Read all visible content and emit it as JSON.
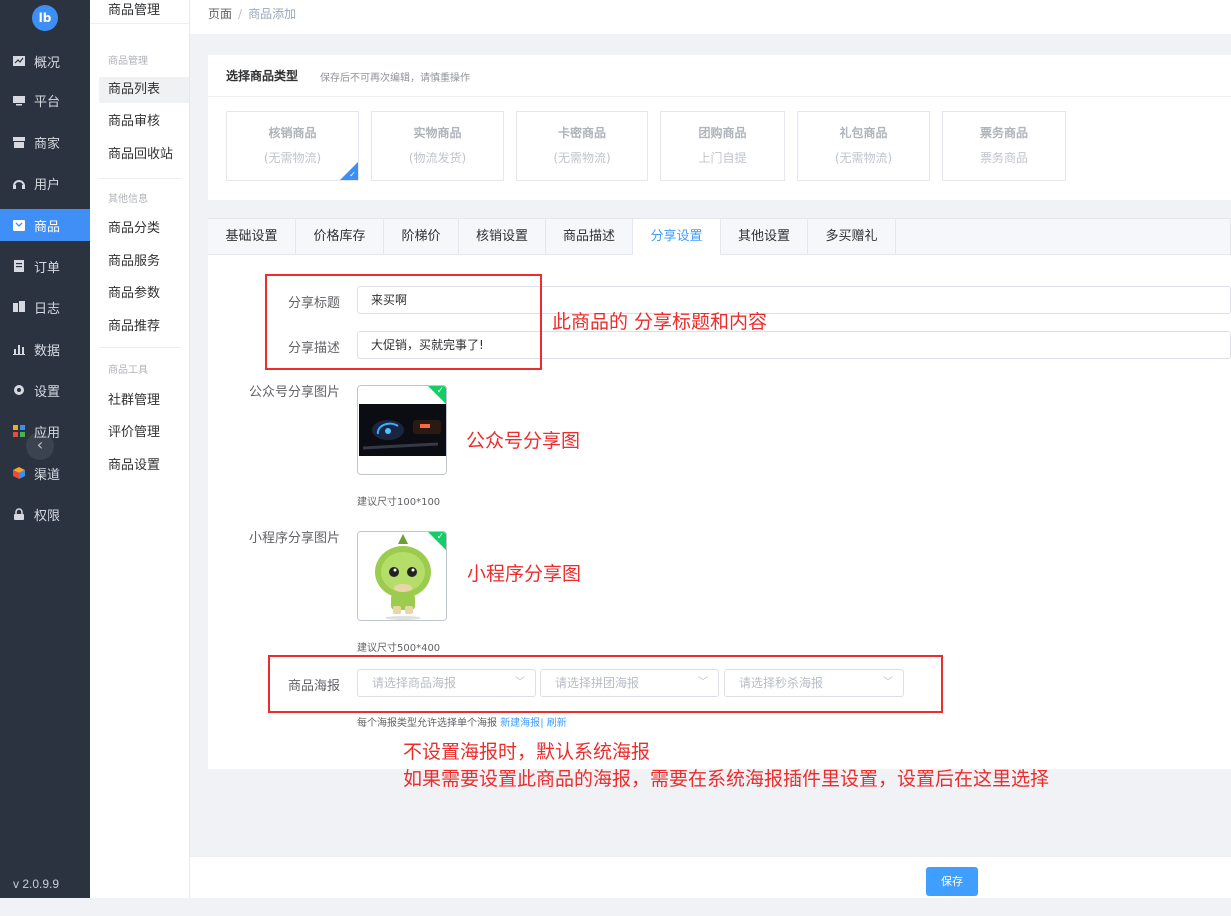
{
  "logo_text": "lb",
  "nav": [
    {
      "label": "概况",
      "icon": "overview-icon"
    },
    {
      "label": "平台",
      "icon": "monitor-icon"
    },
    {
      "label": "商家",
      "icon": "store-icon"
    },
    {
      "label": "用户",
      "icon": "headset-icon"
    },
    {
      "label": "商品",
      "icon": "goods-icon"
    },
    {
      "label": "订单",
      "icon": "order-icon"
    },
    {
      "label": "日志",
      "icon": "log-icon"
    },
    {
      "label": "数据",
      "icon": "chart-icon"
    },
    {
      "label": "设置",
      "icon": "gear-icon"
    },
    {
      "label": "应用",
      "icon": "apps-icon"
    },
    {
      "label": "渠道",
      "icon": "cube-icon"
    },
    {
      "label": "权限",
      "icon": "lock-icon"
    }
  ],
  "version": "v 2.0.9.9",
  "submenu": {
    "title": "商品管理",
    "group1": "商品管理",
    "items1": [
      "商品列表",
      "商品审核",
      "商品回收站"
    ],
    "group2": "其他信息",
    "items2": [
      "商品分类",
      "商品服务",
      "商品参数",
      "商品推荐"
    ],
    "group3": "商品工具",
    "items3": [
      "社群管理",
      "评价管理",
      "商品设置"
    ]
  },
  "breadcrumb": {
    "root": "页面",
    "sep": "/",
    "current": "商品添加"
  },
  "goods_type": {
    "title": "选择商品类型",
    "hint": "保存后不可再次编辑，请慎重操作",
    "options": [
      {
        "name": "核销商品",
        "desc": "(无需物流)"
      },
      {
        "name": "实物商品",
        "desc": "(物流发货)"
      },
      {
        "name": "卡密商品",
        "desc": "(无需物流)"
      },
      {
        "name": "团购商品",
        "desc": "上门自提"
      },
      {
        "name": "礼包商品",
        "desc": "(无需物流)"
      },
      {
        "name": "票务商品",
        "desc": "票务商品"
      }
    ]
  },
  "tabs": [
    "基础设置",
    "价格库存",
    "阶梯价",
    "核销设置",
    "商品描述",
    "分享设置",
    "其他设置",
    "多买赠礼"
  ],
  "form": {
    "share_title_label": "分享标题",
    "share_title_value": "来买啊",
    "share_desc_label": "分享描述",
    "share_desc_value": "大促销，买就完事了!",
    "mp_image_label": "公众号分享图片",
    "mp_image_hint": "建议尺寸100*100",
    "mini_image_label": "小程序分享图片",
    "mini_image_hint": "建议尺寸500*400",
    "poster_label": "商品海报",
    "poster_selects": [
      "请选择商品海报",
      "请选择拼团海报",
      "请选择秒杀海报"
    ],
    "poster_hint": "每个海报类型允许选择单个海报",
    "poster_new": "新建海报",
    "poster_sep": "|",
    "poster_refresh": "刷新"
  },
  "annotations": {
    "share": "此商品的 分享标题和内容",
    "mp": "公众号分享图",
    "mini": "小程序分享图",
    "poster_line1": "不设置海报时，默认系统海报",
    "poster_line2": "如果需要设置此商品的海报，需要在系统海报插件里设置，设置后在这里选择"
  },
  "save_label": "保存",
  "colors": {
    "accent": "#409eff",
    "sidebar": "#2b3340",
    "annotation": "#ee2c2c",
    "badge": "#13ce66"
  }
}
